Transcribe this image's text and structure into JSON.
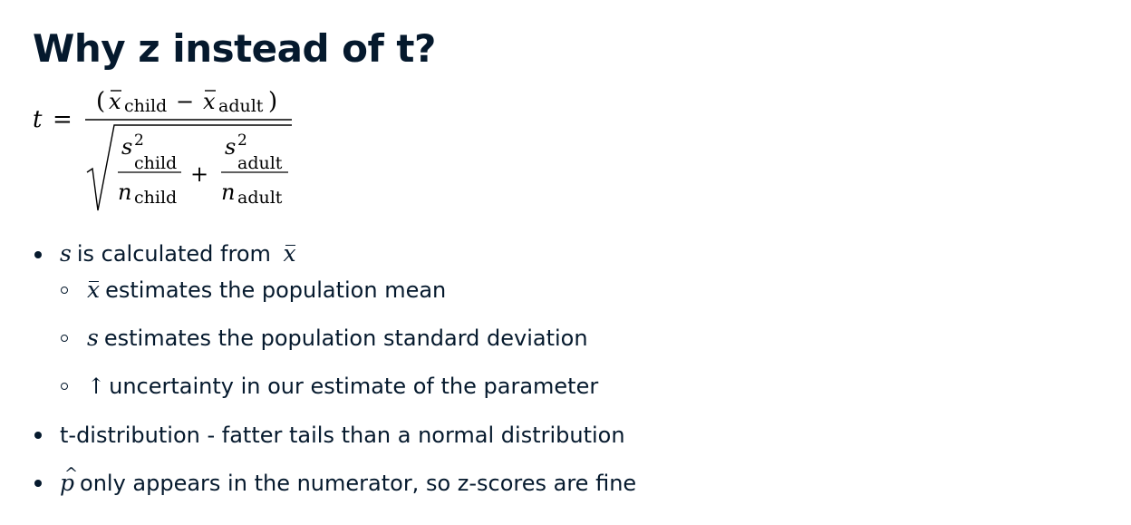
{
  "slide": {
    "title": "Why z instead of t?"
  },
  "formula": {
    "lhs": "t",
    "equals": "=",
    "numerator": {
      "open": "(",
      "x1": "x",
      "sub1": "child",
      "minus": "−",
      "x2": "x",
      "sub2": "adult",
      "close": ")"
    },
    "denominator": {
      "term1": {
        "s": "s",
        "sup": "2",
        "sub": "child",
        "n": "n",
        "nsub": "child"
      },
      "plus": "+",
      "term2": {
        "s": "s",
        "sup": "2",
        "sub": "adult",
        "n": "n",
        "nsub": "adult"
      }
    }
  },
  "bullets": [
    {
      "sym": "s",
      "text": "is calculated from",
      "sym_after": "x"
    },
    {
      "sym": "x",
      "text": "estimates the population mean"
    },
    {
      "sym": "s",
      "text": "estimates the population standard deviation"
    },
    {
      "sym": "↑",
      "text": "uncertainty in our estimate of the parameter"
    },
    {
      "text": "t-distribution - fatter tails than a normal distribution"
    },
    {
      "sym": "p",
      "text": "only appears in the numerator, so z-scores are fine"
    }
  ]
}
